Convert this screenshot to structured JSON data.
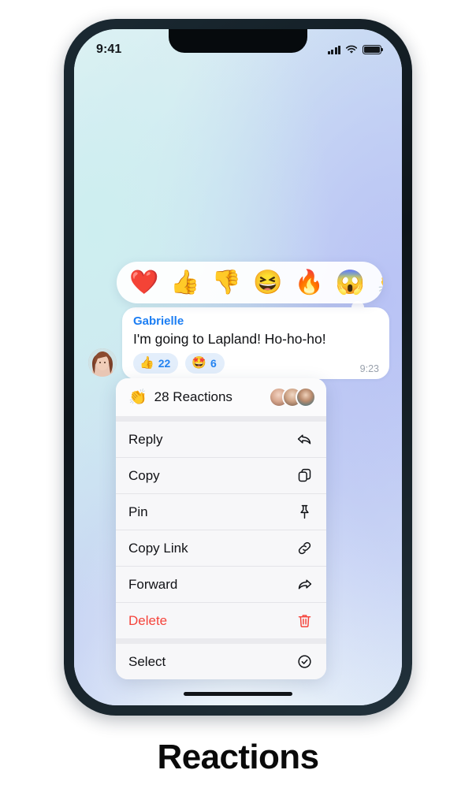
{
  "caption": "Reactions",
  "status_bar": {
    "time": "9:41",
    "signal_icon": "cellular-signal-icon",
    "wifi_icon": "wifi-icon",
    "battery_icon": "battery-full-icon"
  },
  "reaction_picker": {
    "emojis": [
      {
        "name": "red-heart-balloon-emoji",
        "glyph": "❤️"
      },
      {
        "name": "thumbs-up-emoji",
        "glyph": "👍"
      },
      {
        "name": "thumbs-down-emoji",
        "glyph": "👎"
      },
      {
        "name": "grinning-squinting-face-emoji",
        "glyph": "😆"
      },
      {
        "name": "fire-emoji",
        "glyph": "🔥"
      },
      {
        "name": "screaming-face-emoji",
        "glyph": "😱"
      },
      {
        "name": "clapping-hands-emoji",
        "glyph": "👏"
      }
    ]
  },
  "message": {
    "sender": "Gabrielle",
    "text": "I'm going to Lapland! Ho-ho-ho!",
    "time": "9:23",
    "avatar_name": "gabrielle-avatar",
    "reactions": [
      {
        "emoji": "👍",
        "emoji_name": "thumbs-up-emoji",
        "count": "22"
      },
      {
        "emoji": "🤩",
        "emoji_name": "star-struck-emoji",
        "count": "6"
      }
    ]
  },
  "context_menu": {
    "header": {
      "icon": "clapping-hands-icon",
      "icon_glyph": "👏",
      "label": "28 Reactions"
    },
    "items": [
      {
        "label": "Reply",
        "icon": "reply-arrow-icon",
        "danger": false
      },
      {
        "label": "Copy",
        "icon": "copy-icon",
        "danger": false
      },
      {
        "label": "Pin",
        "icon": "pushpin-icon",
        "danger": false
      },
      {
        "label": "Copy Link",
        "icon": "link-icon",
        "danger": false
      },
      {
        "label": "Forward",
        "icon": "forward-arrow-icon",
        "danger": false
      },
      {
        "label": "Delete",
        "icon": "trash-icon",
        "danger": true
      },
      {
        "label": "Select",
        "icon": "check-circle-icon",
        "danger": false
      }
    ]
  },
  "colors": {
    "accent_blue": "#1c7ef3",
    "danger_red": "#f5443c",
    "reaction_pill_bg": "#e3eefb",
    "menu_bg": "#f7f7f9",
    "bezel": "#0d1419"
  }
}
